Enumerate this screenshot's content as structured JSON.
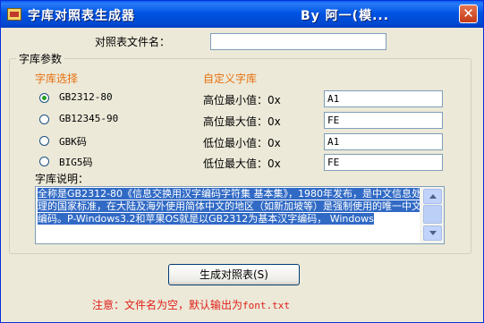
{
  "window": {
    "title_left": "字库对照表生成器",
    "title_right": "By 阿一(模...",
    "close_glyph": "✕"
  },
  "form": {
    "filename_label": "对照表文件名：",
    "filename_value": ""
  },
  "group": {
    "caption": "字库参数",
    "charset_heading": "字库选择",
    "custom_heading": "自定义字库",
    "charsets": [
      {
        "label": "GB2312-80",
        "selected": true
      },
      {
        "label": "GB12345-90",
        "selected": false
      },
      {
        "label": "GBK码",
        "selected": false
      },
      {
        "label": "BIG5码",
        "selected": false
      }
    ],
    "params": [
      {
        "label": "高位最小值：0x",
        "value": "A1"
      },
      {
        "label": "高位最大值：0x",
        "value": "FE"
      },
      {
        "label": "低位最小值：0x",
        "value": "A1"
      },
      {
        "label": "低位最大值：0x",
        "value": "FE"
      }
    ],
    "description_label": "字库说明：",
    "description": "全称是GB2312-80《信息交换用汉字编码字符集 基本集》，1980年发布，是中文信息处理的国家标准，在大陆及海外使用简体中文的地区（如新加坡等）是强制使用的唯一中文编码。P-Windows3.2和苹果OS就是以GB2312为基本汉字编码， Windows"
  },
  "generate_button": "生成对照表(S)",
  "note": {
    "prefix": "注意：文件名为空，默认输出为",
    "filename": "font.txt"
  },
  "colors": {
    "titlebar": "#0054e3",
    "section_heading": "#e8700f",
    "note": "#e0201a",
    "selection": "#316ac5"
  }
}
